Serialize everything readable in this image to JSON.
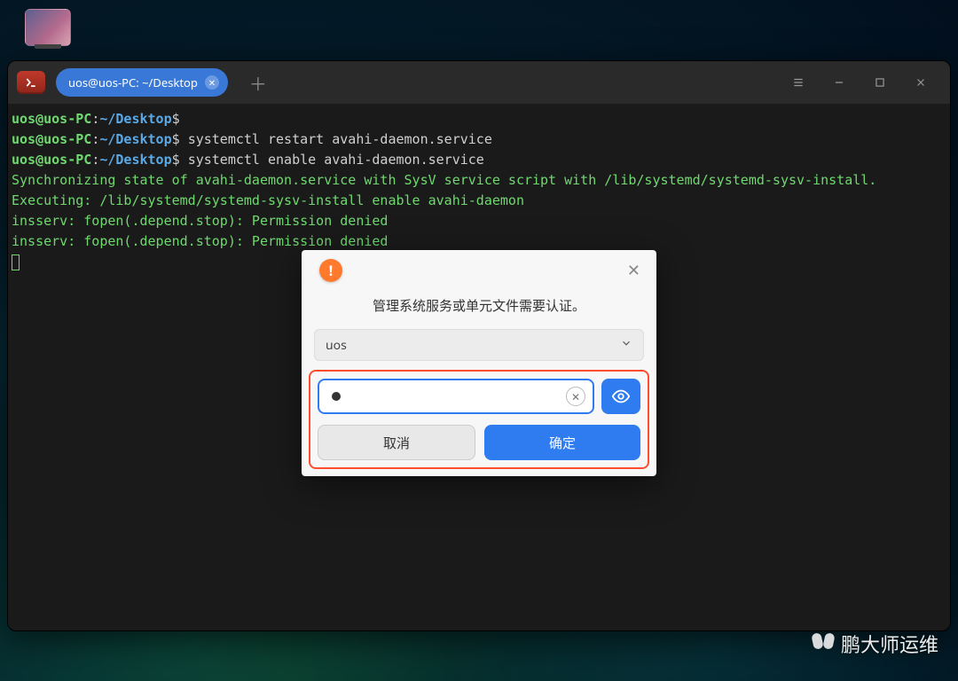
{
  "tab": {
    "title": "uos@uos-PC: ~/Desktop"
  },
  "prompt": {
    "user": "uos",
    "host": "uos-PC",
    "path": "~/Desktop",
    "symbol": "$"
  },
  "lines": {
    "l2_cmd": "systemctl restart avahi-daemon.service",
    "l3_cmd": "systemctl enable avahi-daemon.service",
    "l4": "Synchronizing state of avahi-daemon.service with SysV service script with /lib/systemd/systemd-sysv-install.",
    "l5": "Executing: /lib/systemd/systemd-sysv-install enable avahi-daemon",
    "l6": "insserv: fopen(.depend.stop): Permission denied",
    "l7": "insserv: fopen(.depend.stop): Permission denied"
  },
  "dialog": {
    "message": "管理系统服务或单元文件需要认证。",
    "selected_user": "uos",
    "cancel": "取消",
    "ok": "确定"
  },
  "watermark": {
    "text": "鹏大师运维"
  }
}
